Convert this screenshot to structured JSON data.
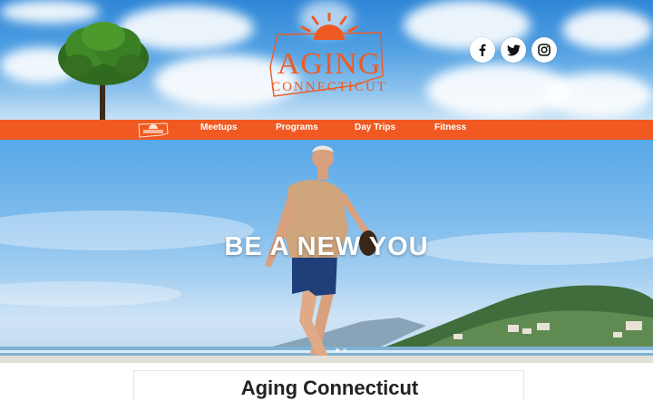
{
  "header": {
    "logo_line1": "AGING",
    "logo_line2": "CONNECTICUT",
    "social": [
      {
        "icon": "facebook-icon"
      },
      {
        "icon": "twitter-icon"
      },
      {
        "icon": "instagram-icon"
      }
    ]
  },
  "nav": {
    "items": [
      {
        "label": "Meetups"
      },
      {
        "label": "Programs"
      },
      {
        "label": "Day Trips"
      },
      {
        "label": "Fitness"
      }
    ]
  },
  "hero": {
    "title": "BE A NEW YOU"
  },
  "main": {
    "title": "Aging Connecticut"
  },
  "colors": {
    "accent": "#f05a22",
    "sky": "#4f9fe2",
    "text_dark": "#222222"
  }
}
